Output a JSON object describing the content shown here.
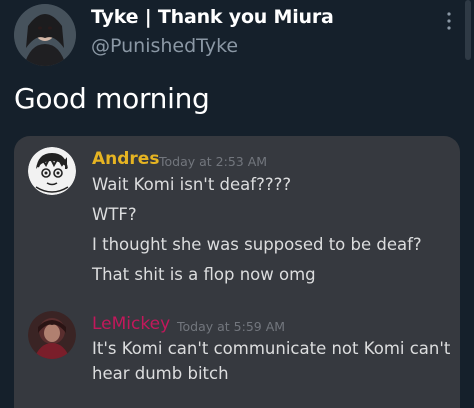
{
  "tweet": {
    "display_name": "Tyke | Thank you Miura",
    "handle": "@PunishedTyke",
    "text": "Good morning",
    "more_icon": "more-vertical-icon"
  },
  "screenshot": {
    "messages": [
      {
        "author": "Andres",
        "author_color": "#e6b422",
        "timestamp": "Today at 2:53 AM",
        "lines": [
          "Wait Komi isn't deaf????",
          "WTF?",
          "I thought she was supposed to be deaf?",
          "That shit is a flop now omg"
        ]
      },
      {
        "author": "LeMickey",
        "author_color": "#c2185b",
        "timestamp": "Today at 5:59 AM",
        "lines": [
          "It's Komi can't communicate not Komi can't",
          "hear dumb bitch"
        ]
      }
    ]
  },
  "colors": {
    "background": "#15202b",
    "card": "#36393f",
    "handle": "#8b98a5"
  }
}
